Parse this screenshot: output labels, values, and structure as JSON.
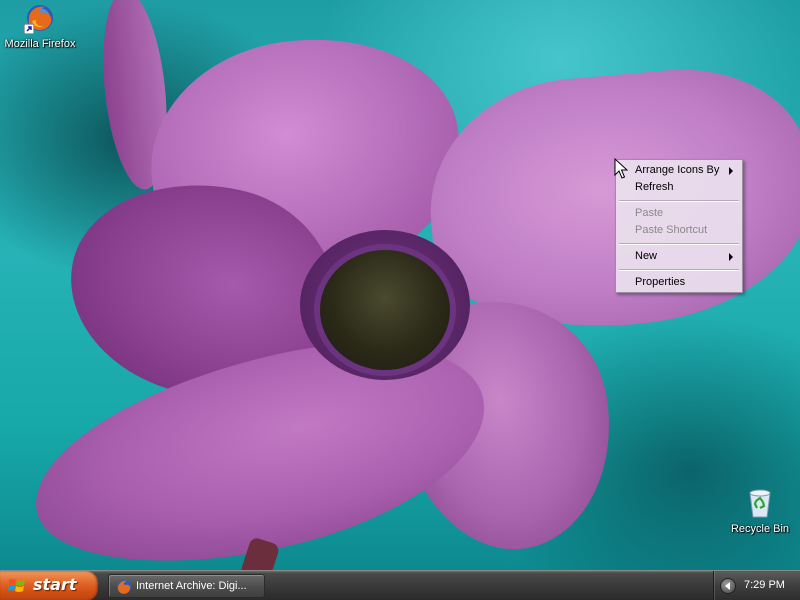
{
  "desktop": {
    "icons": [
      {
        "label": "Mozilla Firefox",
        "icon": "firefox-icon"
      },
      {
        "label": "Recycle Bin",
        "icon": "recycle-bin-icon"
      }
    ]
  },
  "context_menu": {
    "items": [
      {
        "label": "Arrange Icons By",
        "submenu": true,
        "enabled": true
      },
      {
        "label": "Refresh",
        "submenu": false,
        "enabled": true
      },
      {
        "label": "Paste",
        "submenu": false,
        "enabled": false
      },
      {
        "label": "Paste Shortcut",
        "submenu": false,
        "enabled": false
      },
      {
        "label": "New",
        "submenu": true,
        "enabled": true
      },
      {
        "label": "Properties",
        "submenu": false,
        "enabled": true
      }
    ]
  },
  "taskbar": {
    "start_label": "start",
    "tasks": [
      {
        "label": "Internet Archive: Digi...",
        "icon": "firefox-icon"
      }
    ],
    "clock": "7:29 PM"
  },
  "colors": {
    "start_button": "#e3652a",
    "taskbar": "#3a3a3a",
    "menu_background": "#eae0ee",
    "disabled_text": "#8a8a8a"
  }
}
